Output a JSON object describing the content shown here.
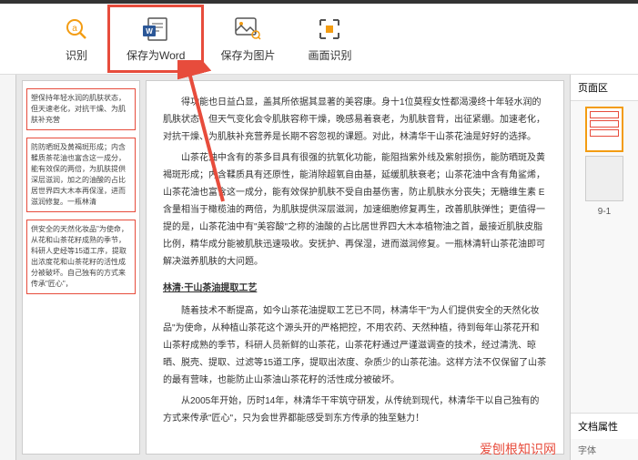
{
  "toolbar": {
    "recognize": {
      "label": "识别"
    },
    "saveWord": {
      "label": "保存为Word"
    },
    "saveImage": {
      "label": "保存为图片"
    },
    "screenRecognize": {
      "label": "画面识别"
    }
  },
  "leftPage": {
    "block1": "塑保持年轻水润的肌肤状态，但天速老化，对抗干燥、为肌肤补充营",
    "block2": "防防晒斑及黄褐斑形成；内含鞣质茶花油也富含这一成分，能有效保的两倍，为肌肤提供深层滋润，加之的油酸的占比居世界四大木本再保湿，进而滋润修复。一瓶林清",
    "block3": "供安全的天然化妆品\"为使命，从花和山茶花籽成熟的季节，科研人史经等15道工序，提取出浓度花和山茶花籽的活性成分被破坏。自己独有的方式来传承\"匠心\"，"
  },
  "centerPage": {
    "p1": "得功能也日益凸显，盖其所依据其显著的美容康。身十1位莫程女性都渴漫终十年轻水润的肌肤状态，但天气变化会令肌肤容称干燥，晚感易着衰老，为肌肤音背，出征紧绷。加速老化，对抗干燥、为肌肤补充营养是长期不容忽视的课题。对此，林清华干山茶花油是好好的选择。",
    "p2": "山茶花油中含有的茶多目具有很强的抗氧化功能，能阻挡紫外线及紫射损伤，能防晒斑及黄褐斑形成；内含鞣质具有还原性，能消除超氧自由基，延缓肌肤衰老；山茶花油中含有角鲨烯，山茶花油也富含这一成分，能有效保护肌肤不受自由基伤害，防止肌肤水分丧失；无糖维生素 E含量相当于橄榄油的两倍，为肌肤提供深层滋润，加速细胞修复再生，改善肌肤弹性；更值得一提的是，山茶花油中有\"美容酸\"之称的油酸的占比居世界四大木本植物油之首，最接近肌肤皮脂比例，精华成分能被肌肤迅速吸收。安抚护、再保湿，进而滋润修复。一瓶林清轩山茶花油即可解决滋养肌肤的大问题。",
    "subtitle": "林清·干山茶油提取工艺",
    "p3": "随着技术不断提高，如今山茶花油提取工艺已不同，林清华干\"为人们提供安全的天然化妆品\"为使命，从种植山茶花这个源头开的严格把控，不用农药、天然种植，待到每年山茶花开和山茶籽成熟的季节，科研人员新鲜的山茶花，山茶花籽通过严谨滋调查的技术，经过清洗、晾晒、脱壳、提取、过滤等15道工序，提取出浓度、杂质少的山茶花油。这样方法不仅保留了山茶的最有营味，也能防止山茶油山茶花籽的活性成分被破坏。",
    "p4": "从2005年开始，历时14年，林清华干牢筑守研发，从传统到现代，林清华干以自己独有的方式来传承\"匠心\"，只为会世界都能感受到东方传承的独至魅力！"
  },
  "rightPanel": {
    "pageArea": "页面区",
    "thumbLabel": "9-1",
    "docProps": "文档属性",
    "font": "字体"
  },
  "watermark": "爱刨根知识网"
}
